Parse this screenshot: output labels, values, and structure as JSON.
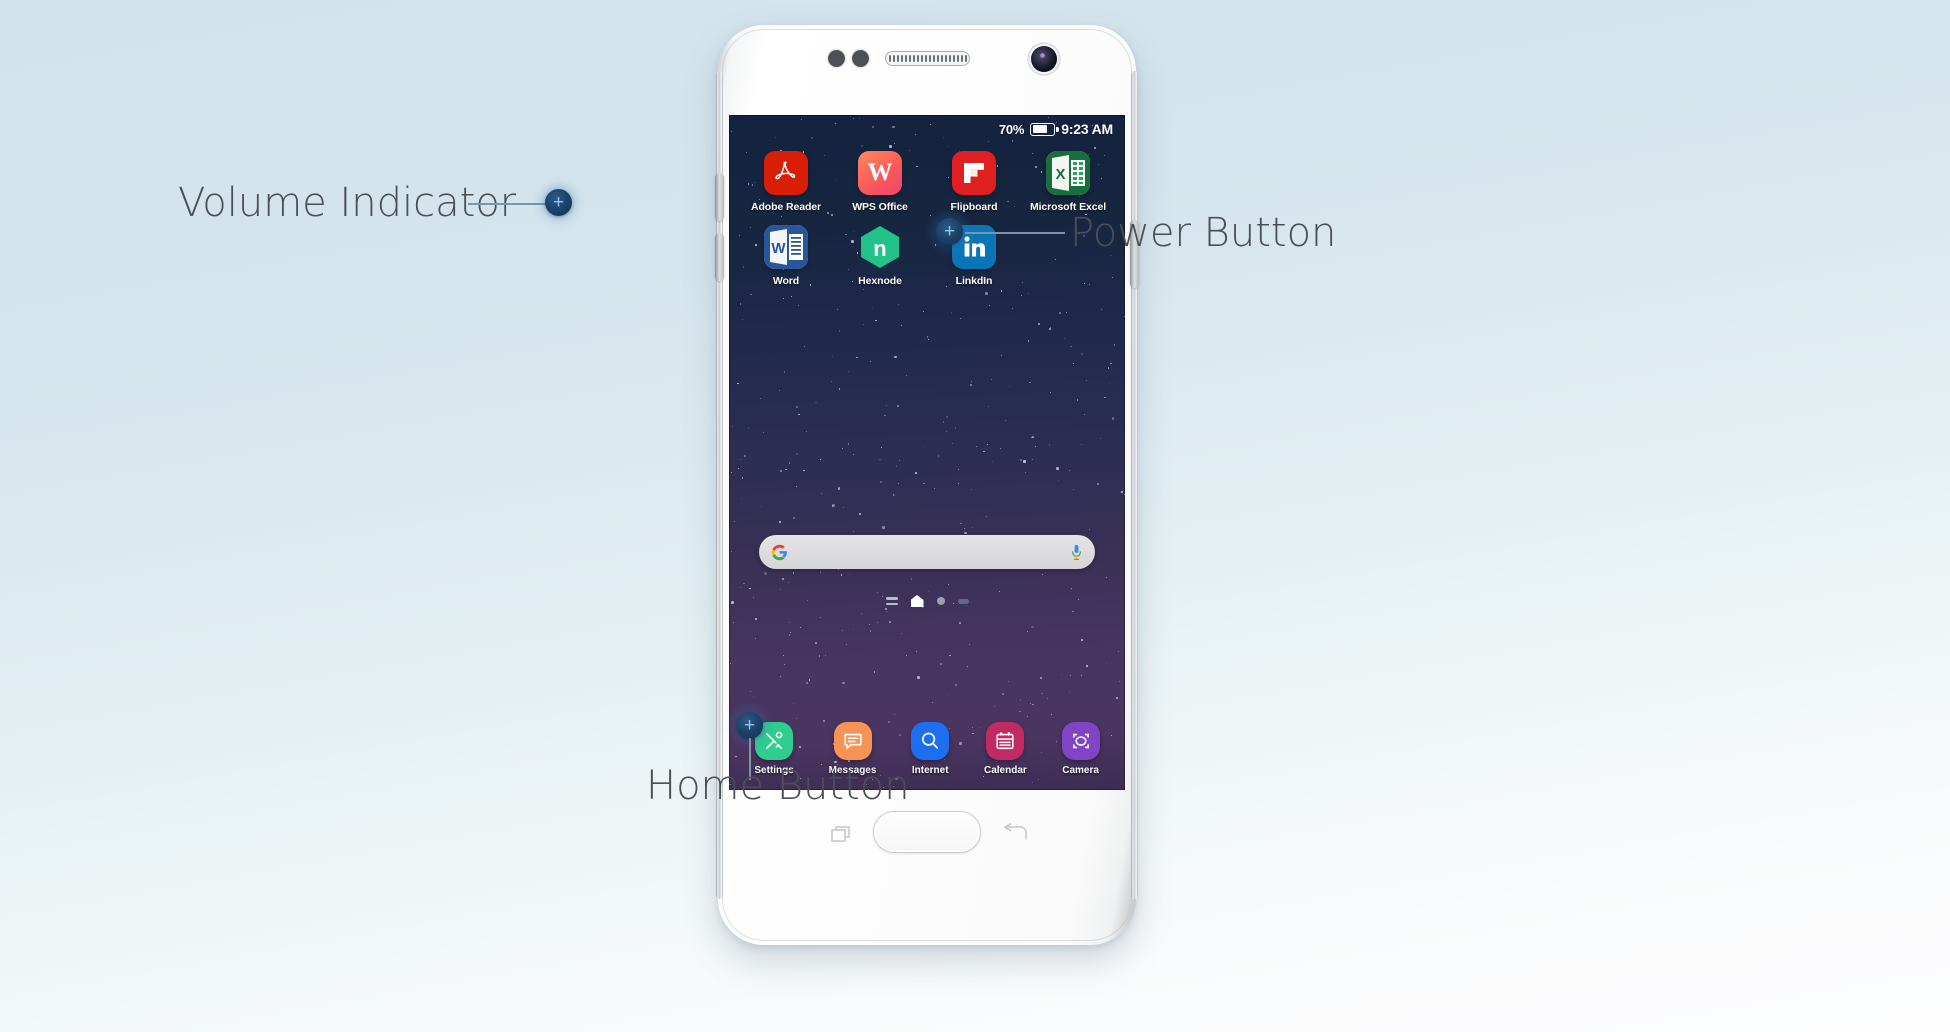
{
  "annotations": [
    {
      "id": "volume",
      "label": "Volume Indicator",
      "marker": "+"
    },
    {
      "id": "power",
      "label": "Power Button",
      "marker": "+"
    },
    {
      "id": "home",
      "label": "Home Button",
      "marker": "+"
    }
  ],
  "phone": {
    "status_bar": {
      "battery_percent": "70%",
      "battery_level_fill": 70,
      "clock": "9:23 AM"
    },
    "apps": [
      {
        "name": "Adobe Reader",
        "icon": "adobe-reader-icon",
        "glyph": "A"
      },
      {
        "name": "WPS Office",
        "icon": "wps-office-icon",
        "glyph": "W"
      },
      {
        "name": "Flipboard",
        "icon": "flipboard-icon",
        "glyph": "F"
      },
      {
        "name": "Microsoft Excel",
        "icon": "microsoft-excel-icon",
        "glyph": "X"
      },
      {
        "name": "Word",
        "icon": "microsoft-word-icon",
        "glyph": "W"
      },
      {
        "name": "Hexnode",
        "icon": "hexnode-icon",
        "glyph": "n"
      },
      {
        "name": "LinkdIn",
        "icon": "linkedin-icon",
        "glyph": "in"
      }
    ],
    "search": {
      "google_logo": "google-g-icon",
      "mic": "microphone-icon",
      "placeholder": ""
    },
    "page_indicator": {
      "apps_list": "apps-list-icon",
      "home_page": "home-page-icon",
      "dots": 2,
      "active_index": 0
    },
    "dock": [
      {
        "name": "Settings",
        "icon": "settings-icon",
        "color": "#2fce8e"
      },
      {
        "name": "Messages",
        "icon": "messages-icon",
        "color": "#f79455"
      },
      {
        "name": "Internet",
        "icon": "internet-icon",
        "color": "#1e6ef0"
      },
      {
        "name": "Calendar",
        "icon": "calendar-icon",
        "color": "#c22a63"
      },
      {
        "name": "Camera",
        "icon": "camera-icon",
        "color": "#8244c6"
      }
    ],
    "nav": {
      "recents": "recents-icon",
      "home": "home-hardware-button",
      "back": "back-icon"
    },
    "hardware": {
      "volume_up": "volume-up-button",
      "volume_down": "volume-down-button",
      "power": "power-button",
      "front_camera": "front-camera-icon",
      "earpiece": "earpiece-speaker",
      "proximity": "proximity-sensor-icon"
    }
  },
  "colors": {
    "background_top": "#d2e3ec",
    "background_bottom": "#fdfdfe",
    "marker_fill": "#1b3f66",
    "marker_glyph": "#8fc4f0",
    "leader_line": "#7d95a6",
    "label_text": "#4a4f55",
    "screen_top": "#13233f",
    "screen_bottom": "#4a3560"
  }
}
